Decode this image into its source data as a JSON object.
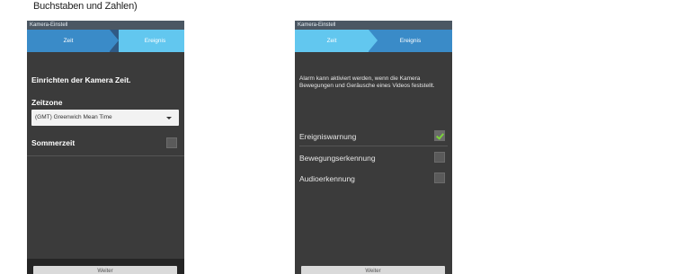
{
  "caption": "Buchstaben und Zahlen)",
  "left_phone": {
    "status_title": "Kamera-Einstell",
    "steps": [
      "Zeit",
      "Ereignis"
    ],
    "heading": "Einrichten der Kamera Zeit.",
    "timezone_label": "Zeitzone",
    "timezone_value": "(GMT) Greenwich Mean Time",
    "dst_label": "Sommerzeit",
    "dst_checked": false,
    "bottom_button": "Weiter"
  },
  "right_phone": {
    "status_title": "Kamera-Einstell",
    "steps": [
      "Zeit",
      "Ereignis"
    ],
    "description": "Alarm kann aktiviert werden, wenn die Kamera Bewegungen und Geräusche eines Videos feststellt.",
    "options": [
      {
        "label": "Ereigniswarnung",
        "checked": true
      },
      {
        "label": "Bewegungserkennung",
        "checked": false
      },
      {
        "label": "Audioerkennung",
        "checked": false
      }
    ],
    "bottom_button": "Weiter"
  },
  "colors": {
    "screen_bg": "#3b3b3b",
    "step_active": "#3a8bc8",
    "step_inactive": "#62c7ef",
    "check_green": "#7bd33a"
  }
}
